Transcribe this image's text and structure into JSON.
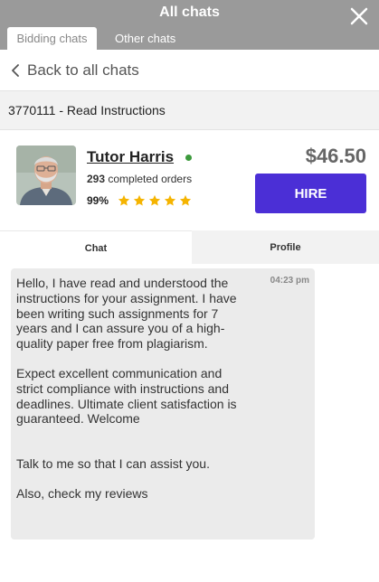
{
  "header": {
    "title": "All chats",
    "close_icon": "close-icon",
    "tabs": [
      {
        "label": "Bidding chats",
        "active": true
      },
      {
        "label": "Other chats",
        "active": false
      }
    ]
  },
  "back_link": {
    "label": "Back to all chats",
    "icon": "chevron-left-icon"
  },
  "order": {
    "title": "3770111 - Read Instructions"
  },
  "tutor": {
    "name": "Tutor Harris",
    "online": true,
    "completed_orders_count": "293",
    "completed_orders_label": "completed orders",
    "rating_percent": "99%",
    "stars": 5,
    "price": "$46.50",
    "hire_label": "HIRE"
  },
  "chat_tabs": [
    {
      "label": "Chat",
      "active": true
    },
    {
      "label": "Profile",
      "active": false
    }
  ],
  "message": {
    "time": "04:23 pm",
    "paragraphs": [
      "Hello, I have read and understood the instructions for your assignment. I have been writing such assignments for 7 years and I can assure you of a high-quality paper free from plagiarism.",
      "Expect excellent communication and strict compliance with instructions and deadlines. Ultimate client satisfaction is guaranteed. Welcome",
      "Talk to me so that I can assist you.",
      "Also, check my reviews"
    ]
  },
  "colors": {
    "header_bg": "#9a9a9a",
    "hire_button": "#4b2fd6",
    "star": "#f5b400",
    "online_dot": "#3c9a3c",
    "bubble_bg": "#ebebeb"
  }
}
